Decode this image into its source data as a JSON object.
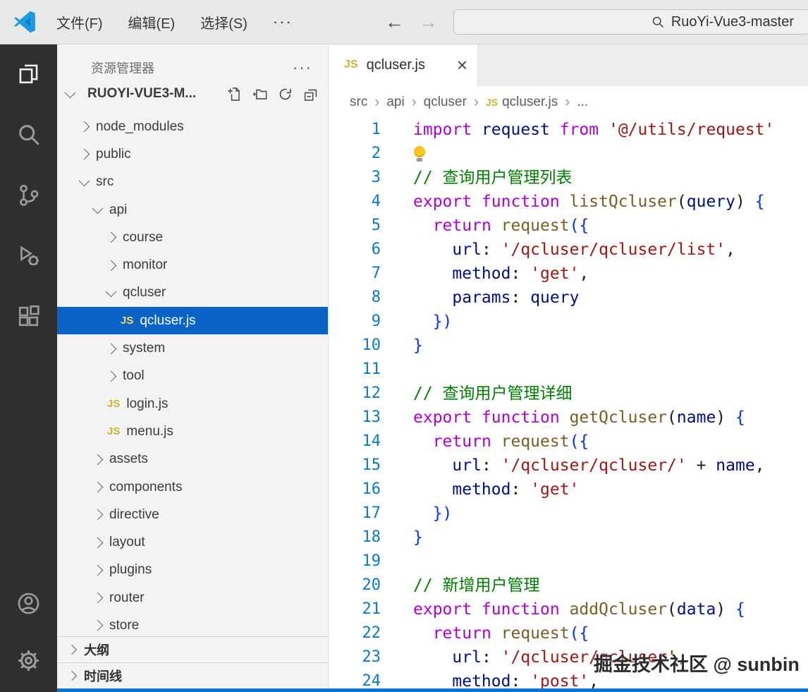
{
  "titlebar": {
    "menus": [
      "文件(F)",
      "编辑(E)",
      "选择(S)"
    ],
    "more_label": "···",
    "back_arrow": "←",
    "forward_arrow": "→",
    "search_value": "RuoYi-Vue3-master"
  },
  "activitybar": {
    "icons": [
      "explorer-icon",
      "search-icon",
      "source-control-icon",
      "run-debug-icon",
      "extensions-icon",
      "account-icon",
      "settings-icon"
    ]
  },
  "sidebar": {
    "title": "资源管理器",
    "more_label": "···",
    "project_label": "RUOYI-VUE3-M...",
    "tree": [
      {
        "label": "node_modules",
        "level": 1,
        "chev": "right"
      },
      {
        "label": "public",
        "level": 1,
        "chev": "right"
      },
      {
        "label": "src",
        "level": 1,
        "chev": "down"
      },
      {
        "label": "api",
        "level": 2,
        "chev": "down"
      },
      {
        "label": "course",
        "level": 3,
        "chev": "right"
      },
      {
        "label": "monitor",
        "level": 3,
        "chev": "right"
      },
      {
        "label": "qcluser",
        "level": 3,
        "chev": "down"
      },
      {
        "label": "qcluser.js",
        "level": 4,
        "icon": "js",
        "selected": true
      },
      {
        "label": "system",
        "level": 3,
        "chev": "right"
      },
      {
        "label": "tool",
        "level": 3,
        "chev": "right"
      },
      {
        "label": "login.js",
        "level": 3,
        "icon": "js"
      },
      {
        "label": "menu.js",
        "level": 3,
        "icon": "js"
      },
      {
        "label": "assets",
        "level": 2,
        "chev": "right"
      },
      {
        "label": "components",
        "level": 2,
        "chev": "right"
      },
      {
        "label": "directive",
        "level": 2,
        "chev": "right"
      },
      {
        "label": "layout",
        "level": 2,
        "chev": "right"
      },
      {
        "label": "plugins",
        "level": 2,
        "chev": "right"
      },
      {
        "label": "router",
        "level": 2,
        "chev": "right"
      },
      {
        "label": "store",
        "level": 2,
        "chev": "right"
      }
    ],
    "panels": [
      {
        "label": "大纲"
      },
      {
        "label": "时间线"
      }
    ]
  },
  "editor": {
    "tab": {
      "label": "qcluser.js",
      "close_label": "×"
    },
    "breadcrumb": {
      "separator": "›",
      "items": [
        {
          "label": "src"
        },
        {
          "label": "api"
        },
        {
          "label": "qcluser"
        },
        {
          "label": "qcluser.js",
          "icon": "js"
        },
        {
          "label": "..."
        }
      ]
    },
    "code_lines": [
      [
        [
          "kw",
          "import "
        ],
        [
          "var",
          "request "
        ],
        [
          "kw",
          "from "
        ],
        [
          "str",
          "'@/utils/request'"
        ]
      ],
      [
        [
          "bulb",
          ""
        ]
      ],
      [
        [
          "cm",
          "// 查询用户管理列表"
        ]
      ],
      [
        [
          "kw",
          "export function "
        ],
        [
          "fn",
          "listQcluser"
        ],
        [
          "pl",
          "("
        ],
        [
          "var",
          "query"
        ],
        [
          "pl",
          ") "
        ],
        [
          "br",
          "{"
        ]
      ],
      [
        [
          "pl",
          "  "
        ],
        [
          "kw",
          "return "
        ],
        [
          "fn",
          "request"
        ],
        [
          "br",
          "({"
        ]
      ],
      [
        [
          "pl",
          "    "
        ],
        [
          "var",
          "url"
        ],
        [
          "pl",
          ": "
        ],
        [
          "str",
          "'/qcluser/qcluser/list'"
        ],
        [
          "pl",
          ","
        ]
      ],
      [
        [
          "pl",
          "    "
        ],
        [
          "var",
          "method"
        ],
        [
          "pl",
          ": "
        ],
        [
          "str",
          "'get'"
        ],
        [
          "pl",
          ","
        ]
      ],
      [
        [
          "pl",
          "    "
        ],
        [
          "var",
          "params"
        ],
        [
          "pl",
          ": "
        ],
        [
          "var",
          "query"
        ]
      ],
      [
        [
          "pl",
          "  "
        ],
        [
          "br",
          "})"
        ]
      ],
      [
        [
          "br",
          "}"
        ]
      ],
      [],
      [
        [
          "cm",
          "// 查询用户管理详细"
        ]
      ],
      [
        [
          "kw",
          "export function "
        ],
        [
          "fn",
          "getQcluser"
        ],
        [
          "pl",
          "("
        ],
        [
          "var",
          "name"
        ],
        [
          "pl",
          ") "
        ],
        [
          "br",
          "{"
        ]
      ],
      [
        [
          "pl",
          "  "
        ],
        [
          "kw",
          "return "
        ],
        [
          "fn",
          "request"
        ],
        [
          "br",
          "({"
        ]
      ],
      [
        [
          "pl",
          "    "
        ],
        [
          "var",
          "url"
        ],
        [
          "pl",
          ": "
        ],
        [
          "str",
          "'/qcluser/qcluser/'"
        ],
        [
          "pl",
          " + "
        ],
        [
          "var",
          "name"
        ],
        [
          "pl",
          ","
        ]
      ],
      [
        [
          "pl",
          "    "
        ],
        [
          "var",
          "method"
        ],
        [
          "pl",
          ": "
        ],
        [
          "str",
          "'get'"
        ]
      ],
      [
        [
          "pl",
          "  "
        ],
        [
          "br",
          "})"
        ]
      ],
      [
        [
          "br",
          "}"
        ]
      ],
      [],
      [
        [
          "cm",
          "// 新增用户管理"
        ]
      ],
      [
        [
          "kw",
          "export function "
        ],
        [
          "fn",
          "addQcluser"
        ],
        [
          "pl",
          "("
        ],
        [
          "var",
          "data"
        ],
        [
          "pl",
          ") "
        ],
        [
          "br",
          "{"
        ]
      ],
      [
        [
          "pl",
          "  "
        ],
        [
          "kw",
          "return "
        ],
        [
          "fn",
          "request"
        ],
        [
          "br",
          "({"
        ]
      ],
      [
        [
          "pl",
          "    "
        ],
        [
          "var",
          "url"
        ],
        [
          "pl",
          ": "
        ],
        [
          "str",
          "'/qcluser/qcluser'"
        ],
        [
          "pl",
          ","
        ]
      ],
      [
        [
          "pl",
          "    "
        ],
        [
          "var",
          "method"
        ],
        [
          "pl",
          ": "
        ],
        [
          "str",
          "'post'"
        ],
        [
          "pl",
          ","
        ]
      ]
    ]
  },
  "icons": {
    "js_label": "JS"
  },
  "watermark": "掘金技术社区 @ sunbin",
  "colors": {
    "selection_blue": "#0a64c8",
    "keyword": "#af00db",
    "string": "#a31515",
    "comment": "#008000",
    "function": "#795e26",
    "variable": "#001080",
    "bracket": "#0431fa",
    "line_number": "#0b7ac4",
    "activity_bar_bg": "#2f2f2f",
    "bottom_strip": "#0b76d1"
  }
}
